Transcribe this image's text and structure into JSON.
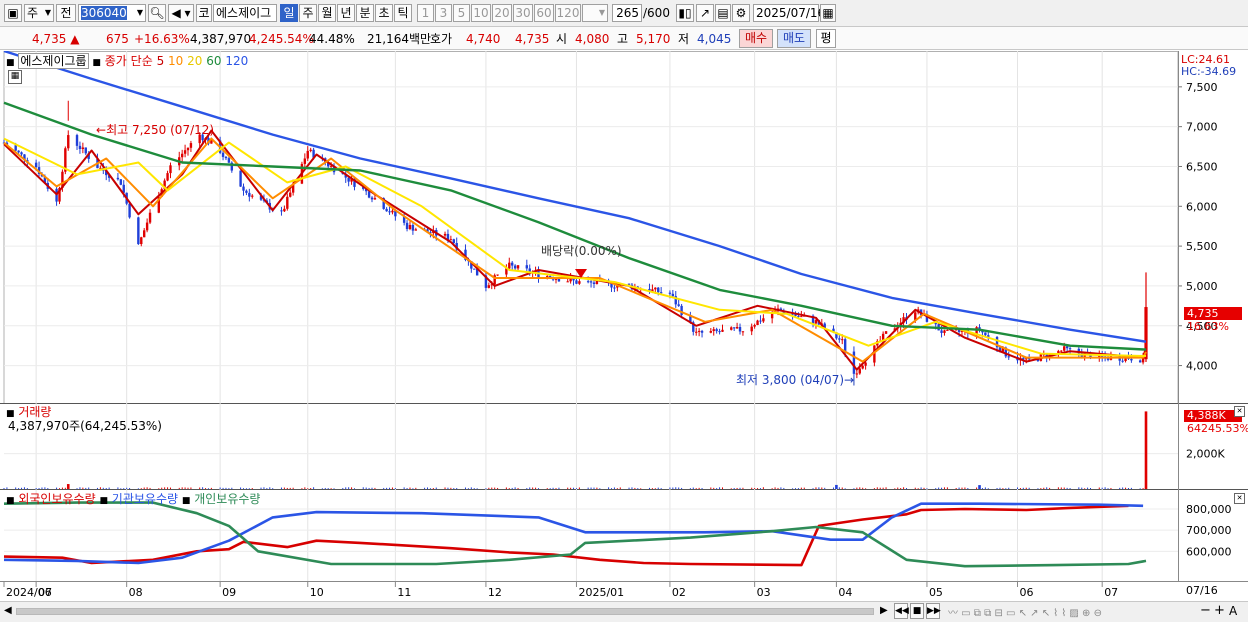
{
  "toolbar": {
    "market_label": "주",
    "prev_label": "전",
    "code": "306040",
    "name_prefix": "코",
    "name": "에스제이그",
    "periods": [
      "일",
      "주",
      "월",
      "년",
      "분",
      "초",
      "틱"
    ],
    "active_period": "일",
    "intervals": [
      "1",
      "3",
      "5",
      "10",
      "20",
      "30",
      "60",
      "120"
    ],
    "count": "265",
    "count_total": "/600",
    "date": "2025/07/16"
  },
  "quote": {
    "price": "4,735",
    "change": "675",
    "change_pct": "+16.63%",
    "volume": "4,387,970",
    "volume_pct": "4,245.54%",
    "turnover": "44.48%",
    "amount": "21,164백만",
    "bid_label": "호가",
    "bid": "4,740",
    "ask": "4,735",
    "open_label": "시",
    "open": "4,080",
    "high_label": "고",
    "high": "5,170",
    "low_label": "저",
    "low": "4,045",
    "buy_label": "매수",
    "sell_label": "매도",
    "eval_label": "평"
  },
  "price_pane": {
    "legend_name": "에스제이그룹",
    "legend_ma": "종가 단순",
    "ma_periods": [
      "5",
      "10",
      "20",
      "60",
      "120"
    ],
    "ma_colors": [
      "#c80000",
      "#ff8c00",
      "#ffe600",
      "#1e8c3c",
      "#2b55e6"
    ],
    "lc": "LC:24.61",
    "hc": "HC:-34.69",
    "annotation_high": "최고 7,250 (07/12)",
    "annotation_low": "최저 3,800 (04/07)",
    "annotation_dividend": "배당락(0.00%)",
    "current_price_tag": "4,735",
    "current_change_tag": "16.63%"
  },
  "volume_pane": {
    "title": "거래량",
    "value": "4,387,970주(64,245.53%)",
    "tag_value": "4,388K",
    "tag_pct": "64245.53%"
  },
  "holdings_pane": {
    "foreign": "외국인보유수량",
    "institution": "기관보유수량",
    "individual": "개인보유수량"
  },
  "bottom": {
    "last_date": "07/16"
  },
  "chart_data": {
    "type": "candlestick",
    "x_range": [
      "2024-06-20",
      "2025-07-16"
    ],
    "x_ticks": [
      {
        "label": "2024/06",
        "date": "2024-06-20"
      },
      {
        "label": "07",
        "date": "2024-07-01"
      },
      {
        "label": "08",
        "date": "2024-08-01"
      },
      {
        "label": "09",
        "date": "2024-09-02"
      },
      {
        "label": "10",
        "date": "2024-10-02"
      },
      {
        "label": "11",
        "date": "2024-11-01"
      },
      {
        "label": "12",
        "date": "2024-12-02"
      },
      {
        "label": "2025/01",
        "date": "2025-01-02"
      },
      {
        "label": "02",
        "date": "2025-02-03"
      },
      {
        "label": "03",
        "date": "2025-03-04"
      },
      {
        "label": "04",
        "date": "2025-04-01"
      },
      {
        "label": "05",
        "date": "2025-05-02"
      },
      {
        "label": "06",
        "date": "2025-06-02"
      },
      {
        "label": "07",
        "date": "2025-07-01"
      }
    ],
    "price_axis": {
      "ticks": [
        4000,
        4500,
        5000,
        5500,
        6000,
        6500,
        7000,
        7500
      ],
      "tick_labels": [
        "4,000",
        "4,500",
        "5,000",
        "5,500",
        "6,000",
        "6,500",
        "7,000",
        "7,500"
      ],
      "ylim": [
        3530,
        7950
      ]
    },
    "volume_axis": {
      "ticks": [
        2000
      ],
      "tick_labels": [
        "2,000K"
      ],
      "ylim": [
        0,
        4750
      ]
    },
    "holdings_axis": {
      "ticks": [
        600000,
        700000,
        800000
      ],
      "tick_labels": [
        "600,000",
        "700,000",
        "800,000"
      ],
      "ylim": [
        460000,
        880000
      ]
    },
    "close_path": [
      [
        "2024-06-20",
        6800
      ],
      [
        "2024-07-01",
        6500
      ],
      [
        "2024-07-08",
        6050
      ],
      [
        "2024-07-12",
        6900
      ],
      [
        "2024-07-22",
        6500
      ],
      [
        "2024-07-30",
        6300
      ],
      [
        "2024-08-05",
        5500
      ],
      [
        "2024-08-09",
        5900
      ],
      [
        "2024-08-16",
        6500
      ],
      [
        "2024-08-26",
        6900
      ],
      [
        "2024-09-02",
        6700
      ],
      [
        "2024-09-10",
        6200
      ],
      [
        "2024-09-23",
        5900
      ],
      [
        "2024-10-02",
        6700
      ],
      [
        "2024-10-10",
        6500
      ],
      [
        "2024-10-25",
        6100
      ],
      [
        "2024-11-05",
        5750
      ],
      [
        "2024-11-20",
        5600
      ],
      [
        "2024-12-02",
        5000
      ],
      [
        "2024-12-10",
        5250
      ],
      [
        "2024-12-20",
        5150
      ],
      [
        "2025-01-02",
        5050
      ],
      [
        "2025-01-20",
        5000
      ],
      [
        "2025-02-03",
        4900
      ],
      [
        "2025-02-12",
        4400
      ],
      [
        "2025-02-28",
        4450
      ],
      [
        "2025-03-12",
        4700
      ],
      [
        "2025-03-25",
        4550
      ],
      [
        "2025-04-03",
        4300
      ],
      [
        "2025-04-07",
        3900
      ],
      [
        "2025-04-18",
        4400
      ],
      [
        "2025-04-28",
        4700
      ],
      [
        "2025-05-08",
        4400
      ],
      [
        "2025-05-20",
        4450
      ],
      [
        "2025-05-29",
        4150
      ],
      [
        "2025-06-05",
        4050
      ],
      [
        "2025-06-18",
        4200
      ],
      [
        "2025-06-30",
        4100
      ],
      [
        "2025-07-10",
        4100
      ],
      [
        "2025-07-15",
        4080
      ],
      [
        "2025-07-16",
        4735
      ]
    ],
    "high_low_points": {
      "high": {
        "date": "2024-07-12",
        "value": 7250
      },
      "low": {
        "date": "2025-04-07",
        "value": 3800
      }
    },
    "today_candle": {
      "date": "2025-07-16",
      "open": 4080,
      "high": 5170,
      "low": 4045,
      "close": 4735
    },
    "series": [
      {
        "name": "5",
        "color": "#c80000",
        "values": [
          [
            "2024-06-20",
            6780
          ],
          [
            "2024-07-08",
            6150
          ],
          [
            "2024-07-20",
            6700
          ],
          [
            "2024-08-05",
            5900
          ],
          [
            "2024-08-20",
            6400
          ],
          [
            "2024-08-30",
            6950
          ],
          [
            "2024-09-20",
            5950
          ],
          [
            "2024-10-05",
            6650
          ],
          [
            "2024-10-25",
            6150
          ],
          [
            "2024-11-20",
            5550
          ],
          [
            "2024-12-05",
            5000
          ],
          [
            "2024-12-20",
            5200
          ],
          [
            "2025-01-20",
            5000
          ],
          [
            "2025-02-12",
            4500
          ],
          [
            "2025-03-05",
            4750
          ],
          [
            "2025-03-25",
            4600
          ],
          [
            "2025-04-08",
            3950
          ],
          [
            "2025-04-28",
            4700
          ],
          [
            "2025-05-15",
            4350
          ],
          [
            "2025-06-05",
            4050
          ],
          [
            "2025-06-20",
            4180
          ],
          [
            "2025-07-15",
            4100
          ],
          [
            "2025-07-16",
            4230
          ]
        ]
      },
      {
        "name": "10",
        "color": "#ff8c00",
        "values": [
          [
            "2024-06-20",
            6800
          ],
          [
            "2024-07-08",
            6250
          ],
          [
            "2024-07-25",
            6600
          ],
          [
            "2024-08-10",
            6000
          ],
          [
            "2024-08-30",
            6850
          ],
          [
            "2024-09-20",
            6100
          ],
          [
            "2024-10-10",
            6600
          ],
          [
            "2024-11-01",
            5950
          ],
          [
            "2024-12-05",
            5100
          ],
          [
            "2025-01-10",
            5100
          ],
          [
            "2025-02-15",
            4550
          ],
          [
            "2025-03-10",
            4700
          ],
          [
            "2025-04-10",
            4050
          ],
          [
            "2025-05-01",
            4650
          ],
          [
            "2025-06-05",
            4100
          ],
          [
            "2025-07-15",
            4100
          ],
          [
            "2025-07-16",
            4170
          ]
        ]
      },
      {
        "name": "20",
        "color": "#ffe600",
        "values": [
          [
            "2024-06-20",
            6850
          ],
          [
            "2024-07-15",
            6400
          ],
          [
            "2024-08-05",
            6550
          ],
          [
            "2024-08-15",
            6200
          ],
          [
            "2024-09-05",
            6800
          ],
          [
            "2024-09-25",
            6300
          ],
          [
            "2024-10-15",
            6500
          ],
          [
            "2024-11-10",
            6000
          ],
          [
            "2024-12-10",
            5200
          ],
          [
            "2025-01-15",
            5050
          ],
          [
            "2025-02-20",
            4700
          ],
          [
            "2025-03-15",
            4650
          ],
          [
            "2025-04-12",
            4250
          ],
          [
            "2025-05-05",
            4550
          ],
          [
            "2025-06-10",
            4150
          ],
          [
            "2025-07-16",
            4120
          ]
        ]
      },
      {
        "name": "60",
        "color": "#1e8c3c",
        "values": [
          [
            "2024-06-20",
            7300
          ],
          [
            "2024-07-20",
            6900
          ],
          [
            "2024-08-20",
            6550
          ],
          [
            "2024-09-20",
            6500
          ],
          [
            "2024-10-20",
            6450
          ],
          [
            "2024-11-20",
            6200
          ],
          [
            "2024-12-20",
            5800
          ],
          [
            "2025-01-20",
            5350
          ],
          [
            "2025-02-20",
            4950
          ],
          [
            "2025-03-20",
            4750
          ],
          [
            "2025-04-20",
            4500
          ],
          [
            "2025-05-20",
            4450
          ],
          [
            "2025-06-20",
            4250
          ],
          [
            "2025-07-16",
            4200
          ]
        ]
      },
      {
        "name": "120",
        "color": "#2b55e6",
        "values": [
          [
            "2024-06-20",
            7950
          ],
          [
            "2024-07-20",
            7600
          ],
          [
            "2024-08-20",
            7250
          ],
          [
            "2024-09-20",
            6900
          ],
          [
            "2024-10-20",
            6600
          ],
          [
            "2024-11-20",
            6350
          ],
          [
            "2024-12-20",
            6100
          ],
          [
            "2025-01-20",
            5850
          ],
          [
            "2025-02-20",
            5500
          ],
          [
            "2025-03-20",
            5150
          ],
          [
            "2025-04-20",
            4850
          ],
          [
            "2025-05-20",
            4650
          ],
          [
            "2025-06-20",
            4450
          ],
          [
            "2025-07-16",
            4300
          ]
        ]
      }
    ],
    "volume_spikes": [
      {
        "date": "2024-07-12",
        "value": 280
      },
      {
        "date": "2025-04-01",
        "value": 230
      },
      {
        "date": "2025-05-20",
        "value": 220
      },
      {
        "date": "2025-07-16",
        "value": 4388
      }
    ],
    "holdings": [
      {
        "name": "외국인보유수량",
        "color": "#d70000",
        "values": [
          [
            "2024-06-20",
            575000
          ],
          [
            "2024-07-10",
            570000
          ],
          [
            "2024-07-20",
            545000
          ],
          [
            "2024-08-10",
            560000
          ],
          [
            "2024-08-25",
            600000
          ],
          [
            "2024-09-05",
            610000
          ],
          [
            "2024-09-10",
            645000
          ],
          [
            "2024-09-25",
            620000
          ],
          [
            "2024-10-05",
            650000
          ],
          [
            "2024-10-20",
            640000
          ],
          [
            "2024-11-20",
            615000
          ],
          [
            "2024-12-10",
            595000
          ],
          [
            "2024-12-25",
            585000
          ],
          [
            "2025-01-10",
            560000
          ],
          [
            "2025-01-25",
            545000
          ],
          [
            "2025-02-10",
            540000
          ],
          [
            "2025-03-20",
            535000
          ],
          [
            "2025-03-26",
            720000
          ],
          [
            "2025-04-10",
            750000
          ],
          [
            "2025-04-25",
            775000
          ],
          [
            "2025-04-30",
            795000
          ],
          [
            "2025-05-15",
            800000
          ],
          [
            "2025-06-05",
            795000
          ],
          [
            "2025-06-20",
            805000
          ],
          [
            "2025-07-10",
            815000
          ]
        ]
      },
      {
        "name": "기관보유수량",
        "color": "#2b55e6",
        "values": [
          [
            "2024-06-20",
            560000
          ],
          [
            "2024-07-15",
            555000
          ],
          [
            "2024-08-05",
            545000
          ],
          [
            "2024-08-20",
            570000
          ],
          [
            "2024-09-05",
            650000
          ],
          [
            "2024-09-20",
            760000
          ],
          [
            "2024-10-05",
            785000
          ],
          [
            "2024-11-10",
            780000
          ],
          [
            "2024-12-20",
            760000
          ],
          [
            "2025-01-05",
            690000
          ],
          [
            "2025-02-15",
            690000
          ],
          [
            "2025-03-10",
            695000
          ],
          [
            "2025-03-30",
            655000
          ],
          [
            "2025-04-10",
            655000
          ],
          [
            "2025-04-20",
            760000
          ],
          [
            "2025-04-30",
            825000
          ],
          [
            "2025-05-20",
            825000
          ],
          [
            "2025-06-30",
            820000
          ],
          [
            "2025-07-15",
            815000
          ]
        ]
      },
      {
        "name": "개인보유수량",
        "color": "#2e8b57",
        "values": [
          [
            "2024-06-20",
            825000
          ],
          [
            "2024-07-15",
            830000
          ],
          [
            "2024-08-10",
            830000
          ],
          [
            "2024-08-25",
            780000
          ],
          [
            "2024-09-05",
            720000
          ],
          [
            "2024-09-15",
            600000
          ],
          [
            "2024-10-10",
            540000
          ],
          [
            "2024-11-15",
            540000
          ],
          [
            "2024-12-10",
            560000
          ],
          [
            "2024-12-31",
            585000
          ],
          [
            "2025-01-05",
            640000
          ],
          [
            "2025-02-10",
            665000
          ],
          [
            "2025-03-10",
            695000
          ],
          [
            "2025-03-25",
            715000
          ],
          [
            "2025-04-10",
            690000
          ],
          [
            "2025-04-25",
            560000
          ],
          [
            "2025-05-15",
            530000
          ],
          [
            "2025-06-15",
            535000
          ],
          [
            "2025-07-10",
            540000
          ],
          [
            "2025-07-16",
            555000
          ]
        ]
      }
    ]
  }
}
